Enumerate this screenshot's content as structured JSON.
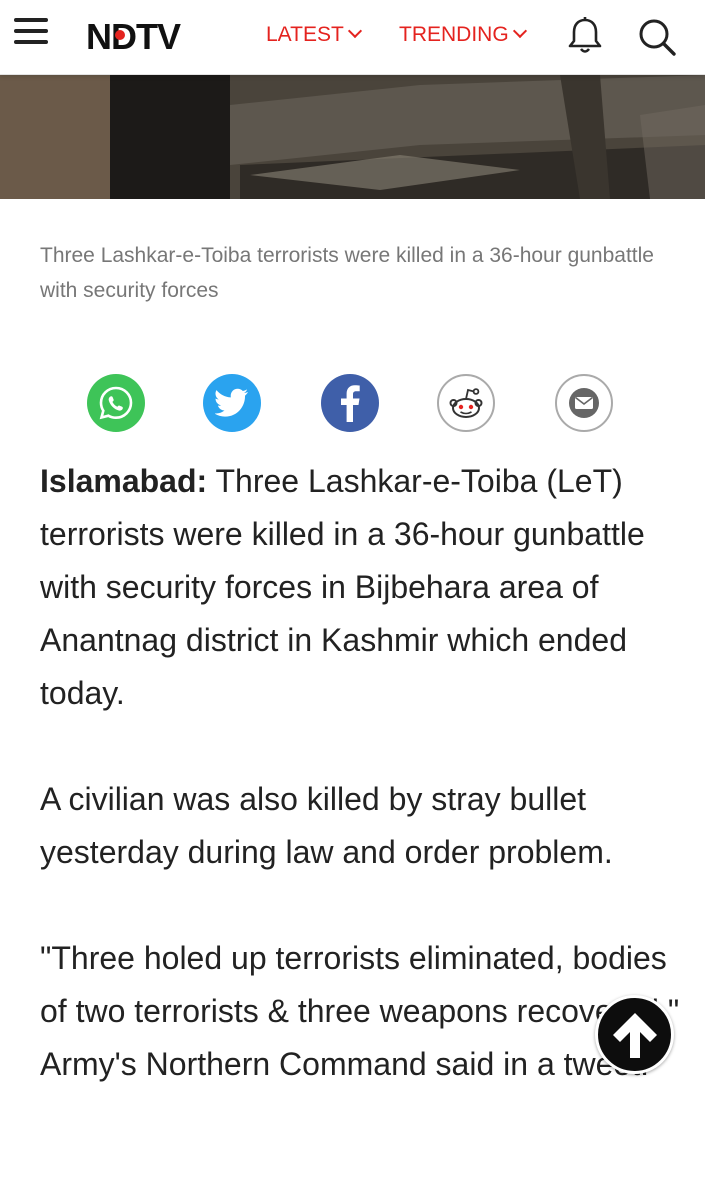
{
  "header": {
    "logo_text": "NDTV",
    "nav": [
      {
        "label": "LATEST"
      },
      {
        "label": "TRENDING"
      }
    ],
    "icons": [
      "hamburger-menu-icon",
      "bell-icon",
      "search-icon"
    ]
  },
  "hero": {
    "caption": "Three Lashkar-e-Toiba terrorists were killed in a 36-hour gunbattle with security forces"
  },
  "share": {
    "buttons": [
      "whatsapp",
      "twitter",
      "facebook",
      "reddit",
      "email"
    ]
  },
  "article": {
    "dateline": "Islamabad:",
    "lead": " Three Lashkar-e-Toiba (LeT) terrorists were killed in a 36-hour gunbattle with security forces in Bijbehara area of Anantnag district in Kashmir which ended today.",
    "paragraphs": [
      "A civilian was also killed by stray bullet yesterday during law and order problem.",
      "\"Three holed up terrorists eliminated, bodies of two terrorists & three weapons recovered,\" Army's Northern Command said in a tweet."
    ]
  },
  "colors": {
    "brand_red": "#e4231f",
    "whatsapp": "#3ec458",
    "twitter": "#2aa3ef",
    "facebook": "#3f5fa9"
  }
}
